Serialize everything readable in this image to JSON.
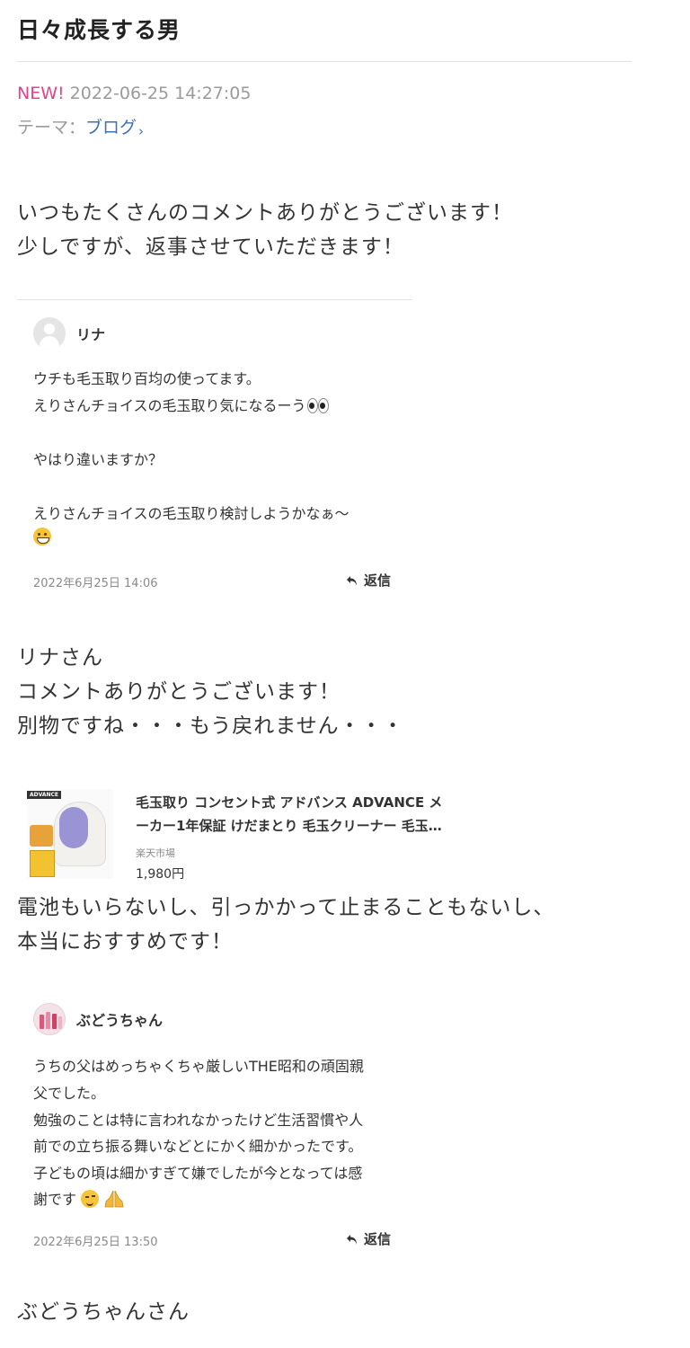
{
  "header": {
    "title": "日々成長する男",
    "new_label": "NEW!",
    "date": "2022-06-25 14:27:05",
    "theme_label": "テーマ：",
    "theme_link": "ブログ"
  },
  "intro": [
    "いつもたくさんのコメントありがとうございます！",
    "少しですが、返事させていただきます！"
  ],
  "comments": [
    {
      "name": "リナ",
      "lines": [
        "ウチも毛玉取り百均の使ってます。",
        "えりさんチョイスの毛玉取り気になるーう",
        "",
        "やはり違いますか？",
        "",
        "えりさんチョイスの毛玉取り検討しようかなぁ〜"
      ],
      "date": "2022年6月25日 14:06",
      "reply_label": "返信",
      "emoji": [
        "eyes-icon",
        "grinning-face-icon"
      ]
    },
    {
      "name": "ぶどうちゃん",
      "lines": [
        "うちの父はめっちゃくちゃ厳しいTHE昭和の頑固親",
        "父でした。",
        "勉強のことは特に言われなかったけど生活習慣や人",
        "前での立ち振る舞いなどとにかく細かかったです。",
        "子どもの頃は細かすぎて嫌でしたが今となっては感",
        "謝です"
      ],
      "date": "2022年6月25日 13:50",
      "reply_label": "返信",
      "emoji": [
        "winking-face-icon",
        "folded-hands-icon"
      ]
    }
  ],
  "reply1": [
    "リナさん",
    "コメントありがとうございます！",
    "別物ですね・・・もう戻れません・・・"
  ],
  "product": {
    "brand": "ADVANCE",
    "title_line1": "毛玉取り コンセント式 アドバンス ADVANCE メ",
    "title_line2": "ーカー1年保証 けだまとり 毛玉クリーナー 毛玉…",
    "shop": "楽天市場",
    "price": "1,980円"
  },
  "reply1_after": [
    "電池もいらないし、引っかかって止まることもないし、",
    "本当におすすめです！"
  ],
  "reply2": [
    "ぶどうちゃんさん"
  ],
  "colors": {
    "new": "#e0438b",
    "link": "#3d70b2",
    "meta": "#9a9a9a"
  }
}
